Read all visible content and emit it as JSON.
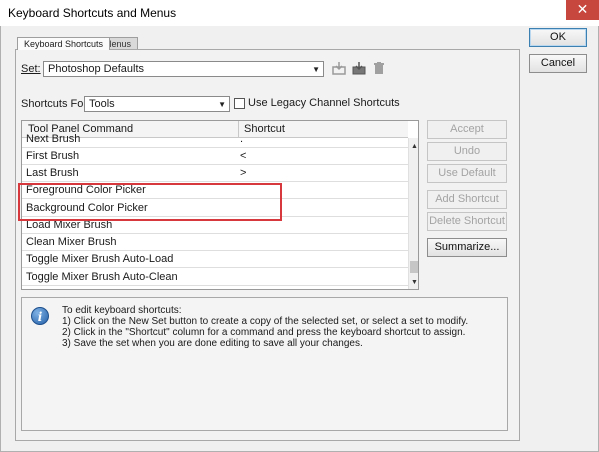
{
  "window": {
    "title": "Keyboard Shortcuts and Menus",
    "close_glyph": "✕"
  },
  "tabs": [
    {
      "label": "Keyboard Shortcuts",
      "active": true
    },
    {
      "label": "Menus",
      "active": false
    }
  ],
  "set": {
    "label": "Set:",
    "value": "Photoshop Defaults",
    "icons": [
      "save-set-icon",
      "save-set-as-icon",
      "delete-set-icon"
    ]
  },
  "shortcuts_for": {
    "label": "Shortcuts For:",
    "value": "Tools",
    "legacy_label": "Use Legacy Channel Shortcuts",
    "legacy_checked": false
  },
  "table": {
    "columns": [
      "Tool Panel Command",
      "Shortcut"
    ],
    "rows": [
      {
        "command": "Next Brush",
        "shortcut": "."
      },
      {
        "command": "First Brush",
        "shortcut": "<"
      },
      {
        "command": "Last Brush",
        "shortcut": ">"
      },
      {
        "command": "Foreground Color Picker",
        "shortcut": ""
      },
      {
        "command": "Background Color Picker",
        "shortcut": ""
      },
      {
        "command": "Load Mixer Brush",
        "shortcut": ""
      },
      {
        "command": "Clean Mixer Brush",
        "shortcut": ""
      },
      {
        "command": "Toggle Mixer Brush Auto-Load",
        "shortcut": ""
      },
      {
        "command": "Toggle Mixer Brush Auto-Clean",
        "shortcut": ""
      }
    ]
  },
  "buttons": {
    "ok": "OK",
    "cancel": "Cancel",
    "accept": "Accept",
    "undo": "Undo",
    "use_default": "Use Default",
    "add_shortcut": "Add Shortcut",
    "delete_shortcut": "Delete Shortcut",
    "summarize": "Summarize..."
  },
  "info": {
    "lines": [
      "To edit keyboard shortcuts:",
      "1) Click on the New Set button to create a copy of the selected set, or select a set to modify.",
      "2) Click in the \"Shortcut\" column for a command and press the keyboard shortcut to assign.",
      "3) Save the set when you are done editing to save all your changes."
    ]
  },
  "colors": {
    "highlight": "#d7383d",
    "close_button": "#c7463e",
    "info_icon": "#2460a8"
  }
}
